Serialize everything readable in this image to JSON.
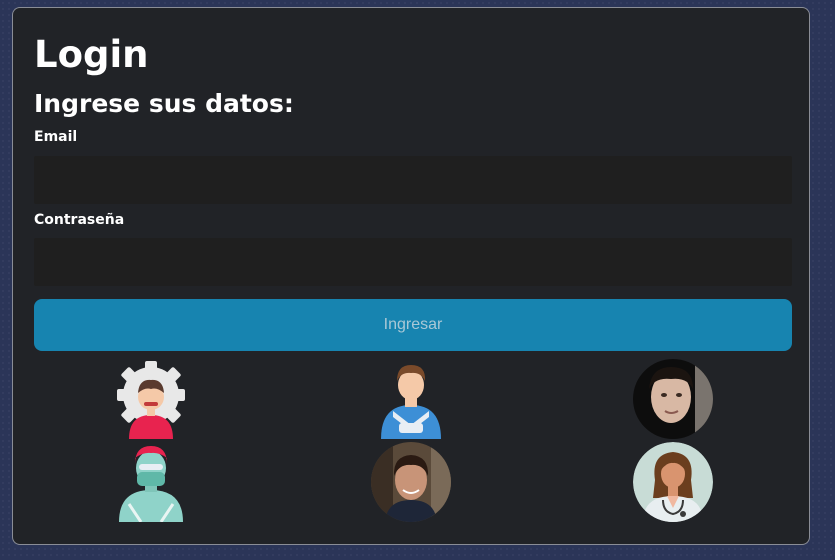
{
  "login": {
    "title": "Login",
    "subtitle": "Ingrese sus datos:",
    "email_label": "Email",
    "email_value": "",
    "password_label": "Contraseña",
    "password_value": "",
    "submit_label": "Ingresar"
  },
  "avatars": [
    {
      "name": "engineer-avatar"
    },
    {
      "name": "injured-patient-avatar"
    },
    {
      "name": "user-photo-avatar-1"
    },
    {
      "name": "surgeon-avatar"
    },
    {
      "name": "user-photo-avatar-2"
    },
    {
      "name": "doctor-avatar"
    }
  ],
  "colors": {
    "background": "#2b3558",
    "card": "#212327",
    "input": "#1f1f1f",
    "button": "#1784b0",
    "button_text": "#a9c8d6"
  }
}
